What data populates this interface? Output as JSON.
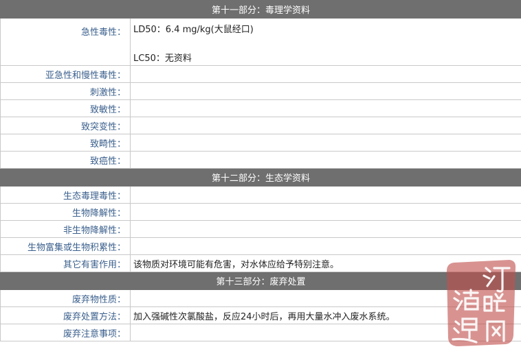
{
  "sections": [
    {
      "title": "第十一部分：毒理学资料",
      "rows": [
        {
          "label": "急性毒性：",
          "lines": [
            "LD50：6.4 mg/kg(大鼠经口)",
            "LC50：无资料"
          ]
        },
        {
          "label": "亚急性和慢性毒性：",
          "value": ""
        },
        {
          "label": "刺激性：",
          "value": ""
        },
        {
          "label": "致敏性：",
          "value": ""
        },
        {
          "label": "致突变性：",
          "value": ""
        },
        {
          "label": "致畸性：",
          "value": ""
        },
        {
          "label": "致癌性：",
          "value": ""
        }
      ]
    },
    {
      "title": "第十二部分：生态学资料",
      "rows": [
        {
          "label": "生态毒理毒性：",
          "value": ""
        },
        {
          "label": "生物降解性：",
          "value": ""
        },
        {
          "label": "非生物降解性：",
          "value": ""
        },
        {
          "label": "生物富集或生物积累性：",
          "value": ""
        },
        {
          "label": "其它有害作用：",
          "value": "该物质对环境可能有危害，对水体应给予特别注意。"
        }
      ]
    },
    {
      "title": "第十三部分：废弃处置",
      "rows": [
        {
          "label": "废弃物性质：",
          "value": ""
        },
        {
          "label": "废弃处置方法：",
          "value": "加入强碱性次氯酸盐，反应24小时后，再用大量水冲入废水系统。"
        },
        {
          "label": "废弃注意事项：",
          "value": ""
        }
      ]
    }
  ],
  "watermark": {
    "text": "海运订舱网",
    "color": "#c0504d"
  }
}
